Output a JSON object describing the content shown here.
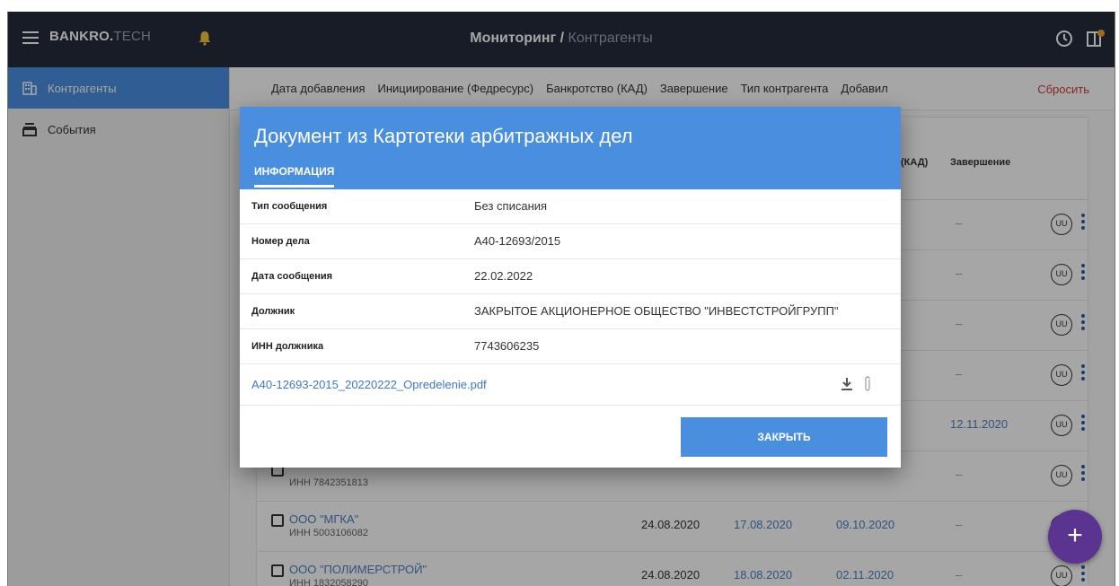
{
  "header": {
    "logo_main": "BANKRO.",
    "logo_sub": "TECH",
    "breadcrumb_current": "Мониторинг",
    "breadcrumb_sep": " / ",
    "breadcrumb_sub": "Контрагенты"
  },
  "sidebar": {
    "items": [
      {
        "label": "Контрагенты",
        "icon": "building-icon",
        "active": true
      },
      {
        "label": "События",
        "icon": "stack-icon",
        "active": false
      }
    ]
  },
  "filters": {
    "items": [
      "Дата добавления",
      "Инициирование (Федресурс)",
      "Банкротство (КАД)",
      "Завершение",
      "Тип контрагента",
      "Добавил"
    ],
    "reset": "Сбросить"
  },
  "table": {
    "headers": [
      "(КАД)",
      "Завершение"
    ],
    "rows": [
      {
        "name": "",
        "inn": "",
        "d1": "",
        "d2": "",
        "d3": "",
        "d4": "",
        "badge": "UU"
      },
      {
        "name": "",
        "inn": "",
        "d1": "",
        "d2": "",
        "d3": "",
        "d4": "",
        "badge": "UU"
      },
      {
        "name": "",
        "inn": "",
        "d1": "",
        "d2": "",
        "d3": "",
        "d4": "",
        "badge": "UU"
      },
      {
        "name": "",
        "inn": "",
        "d1": "",
        "d2": "",
        "d3": "",
        "d4": "",
        "badge": "UU"
      },
      {
        "name": "",
        "inn": "",
        "d1": "",
        "d2": "",
        "d3": "",
        "d4": "12.11.2020",
        "badge": "UU"
      },
      {
        "name": "",
        "inn": "ИНН 7842351813",
        "d1": "",
        "d2": "",
        "d3": "",
        "d4": "",
        "badge": "UU"
      },
      {
        "name": "ООО \"МГКА\"",
        "inn": "ИНН 5003106082",
        "d1": "24.08.2020",
        "d2": "17.08.2020",
        "d3": "09.10.2020",
        "d4": "",
        "badge": "UU"
      },
      {
        "name": "ООО \"ПОЛИМЕРСТРОЙ\"",
        "inn": "ИНН 1832058290",
        "d1": "24.08.2020",
        "d2": "18.08.2020",
        "d3": "02.11.2020",
        "d4": "",
        "badge": "UU"
      }
    ],
    "dash": "–"
  },
  "dialog": {
    "title": "Документ из Картотеки арбитражных дел",
    "tab": "ИНФОРМАЦИЯ",
    "fields": [
      {
        "key": "Тип сообщения",
        "value": "Без списания"
      },
      {
        "key": "Номер дела",
        "value": "А40-12693/2015"
      },
      {
        "key": "Дата сообщения",
        "value": "22.02.2022"
      },
      {
        "key": "Должник",
        "value": "ЗАКРЫТОЕ АКЦИОНЕРНОЕ ОБЩЕСТВО \"ИНВЕСТСТРОЙГРУПП\""
      },
      {
        "key": "ИНН должника",
        "value": "7743606235"
      }
    ],
    "file_name": "А40-12693-2015_20220222_Opredelenie.pdf",
    "close_label": "ЗАКРЫТЬ"
  },
  "fab_label": "+",
  "colors": {
    "header_bg": "#252c3c",
    "accent_blue": "#4a8ee0",
    "reset_red": "#d13b3b",
    "fab_purple": "#5b3391"
  }
}
